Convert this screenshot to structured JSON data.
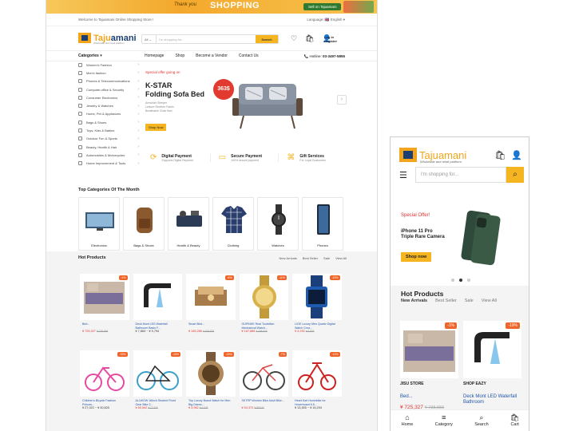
{
  "desktop": {
    "promo": {
      "text": "SHOPPING",
      "left_text": "Thank you",
      "btn": "Sell on Tajuamani"
    },
    "topline": {
      "welcome": "Welcome to Tajuamani Online Shopping Store !",
      "language": "Language: 🇬🇧 English ▾"
    },
    "logo": {
      "name_a": "Taju",
      "name_b": "amani",
      "tagline": "Wholesale and retail platform"
    },
    "search": {
      "category": "All ⌄",
      "placeholder": "I'm shopping for...",
      "button": "Search"
    },
    "login": {
      "line1": "Log in",
      "line2": "Register"
    },
    "nav": {
      "categories": "Categories ▾",
      "items": [
        "Homepage",
        "Shop",
        "Become a Vendor",
        "Contact Us"
      ],
      "hotline_label": "Hotline:",
      "hotline": "03-3497-5855"
    },
    "sidebar": [
      "Women's Fashion",
      "Men's fashion",
      "Phones & Telecommunications",
      "Computer,office & Security",
      "Consumer Electronics",
      "Jewelry & Watches",
      "Home, Pet & Appliances",
      "Bags & Shoes",
      "Toys, Kids & Babies",
      "Outdoor Fun & Sports",
      "Beauty, Health & Hair",
      "Automobiles & Motorcycles",
      "Home Improvement & Tools"
    ],
    "hero": {
      "offer": "Special offer going on",
      "title_1": "K-STAR",
      "title_2": "Folding Sofa Bed",
      "desc_1": "Armchair Sleeper",
      "desc_2": "Leisure Recliner Fabric",
      "desc_3": "Breathable Chair Bed",
      "price": "363$",
      "shop": "Shop Now"
    },
    "features": [
      {
        "title": "Digital Payment",
        "sub": "Supports Digital Payment"
      },
      {
        "title": "Secure Payment",
        "sub": "100% secure payment"
      },
      {
        "title": "Gift Services",
        "sub": "For Loyal Customers"
      }
    ],
    "topcats_title": "Top Categories Of The Month",
    "topcats": [
      "Electronics",
      "Bags & Shoes",
      "Health & Beauty",
      "Clothing",
      "Watches",
      "Phones"
    ],
    "hot": {
      "title": "Hot Products",
      "tabs": [
        "New Arrivals",
        "Best Seller",
        "Sale",
        "View All"
      ],
      "products": [
        {
          "name": "Bed...",
          "price": "¥ 725,327",
          "old": "¥ 735,656",
          "off": "-1%"
        },
        {
          "name": "Deck Mont LED Waterfall Bathroom Basin F...",
          "price": "¥ 7,863 ~ ¥ 9,794",
          "off": ""
        },
        {
          "name": "Smart Bed...",
          "price": "¥ 145,286",
          "old": "¥ 166,928",
          "off": "-8%"
        },
        {
          "name": "OUPINKE Real Tourbillon Mechanical Watch...",
          "price": "¥ 167,886",
          "old": "¥ 188,876",
          "off": "-11%"
        },
        {
          "name": "LIGE Luxury Men Quartz Digital Watch Crea...",
          "price": "¥ 3,292",
          "old": "¥ 3,876",
          "off": "-15%"
        },
        {
          "name": "Children's Bicycle Fashion Princes...",
          "price": "¥ 27,022 ~ ¥ 30,825",
          "off": "-33%"
        },
        {
          "name": "ALLWOW 16inch Student Fixed Gear Bike 2...",
          "price": "¥ 69,542",
          "old": "¥ 77,203",
          "off": "-10%"
        },
        {
          "name": "Top Luxury Brand Watch for Men Big Diamo...",
          "price": "¥ 3,962",
          "old": "¥ 4,676",
          "off": "-15%"
        },
        {
          "name": "SKTRP Women Bike Adult Bike...",
          "price": "¥ 54,372",
          "old": "¥ 58,540",
          "off": "-7%"
        },
        {
          "name": "Heart Kart Hoverbike for Hoverboard 6.5...",
          "price": "¥ 13,305 ~ ¥ 15,293",
          "off": "-12%"
        }
      ]
    }
  },
  "mobile": {
    "logo": {
      "name": "Tajuamani",
      "tagline": "Wholesale and retail platform"
    },
    "search_placeholder": "I'm shopping for...",
    "hero": {
      "offer": "Special Offer!",
      "title_1": "iPhone 11 Pro",
      "title_2": "Triple Rare Camera",
      "shop": "Shop now"
    },
    "hot": {
      "title": "Hot Products",
      "tabs": [
        "New Arrivals",
        "Best Seller",
        "Sale",
        "View All"
      ],
      "cards": [
        {
          "shop": "JISU STORE",
          "name": "Bed...",
          "price": "¥ 725,327",
          "old": "¥ 735,656",
          "off": "-1%"
        },
        {
          "shop": "SHOP EAZY",
          "name": "Deck Mont LED Waterfall Bathroom",
          "price": "",
          "old": "",
          "off": "-19%"
        }
      ]
    },
    "bottom_nav": [
      "Home",
      "Category",
      "Search",
      "Cart"
    ]
  },
  "colors": {
    "accent": "#f5b521",
    "brand_blue": "#1c3f73",
    "sale_red": "#e03030",
    "badge": "#f06529"
  }
}
